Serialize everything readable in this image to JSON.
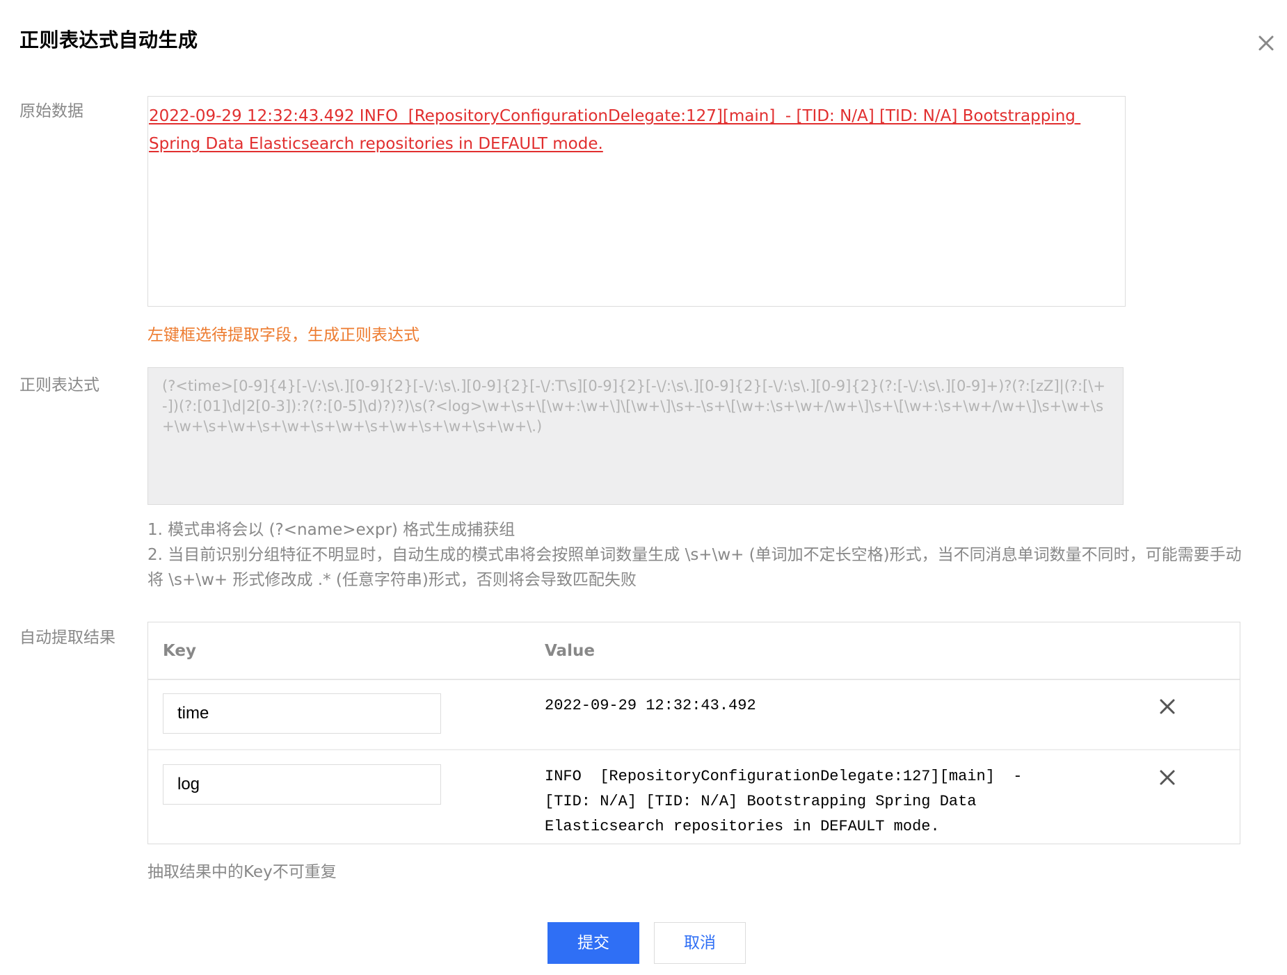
{
  "dialog": {
    "title": "正则表达式自动生成"
  },
  "raw_data": {
    "label": "原始数据",
    "text": "2022-09-29 12:32:43.492 INFO  [RepositoryConfigurationDelegate:127][main]  - [TID: N/A] [TID: N/A] Bootstrapping Spring Data Elasticsearch repositories in DEFAULT mode.",
    "hint": "左键框选待提取字段，生成正则表达式"
  },
  "regex": {
    "label": "正则表达式",
    "value": "(?<time>[0-9]{4}[-\\/:\\s\\.][0-9]{2}[-\\/:\\s\\.][0-9]{2}[-\\/:T\\s][0-9]{2}[-\\/:\\s\\.][0-9]{2}[-\\/:\\s\\.][0-9]{2}(?:[-\\/:\\s\\.][0-9]+)?(?:[zZ]|(?:[\\+-])(?:[01]\\d|2[0-3]):?(?:[0-5]\\d)?)?)\\s(?<log>\\w+\\s+\\[\\w+:\\w+\\]\\[\\w+\\]\\s+-\\s+\\[\\w+:\\s+\\w+/\\w+\\]\\s+\\[\\w+:\\s+\\w+/\\w+\\]\\s+\\w+\\s+\\w+\\s+\\w+\\s+\\w+\\s+\\w+\\s+\\w+\\s+\\w+\\s+\\w+\\.)",
    "note_1": "1. 模式串将会以 (?<name>expr) 格式生成捕获组",
    "note_2": "2. 当目前识别分组特征不明显时，自动生成的模式串将会按照单词数量生成 \\s+\\w+ (单词加不定长空格)形式，当不同消息单词数量不同时，可能需要手动将 \\s+\\w+ 形式修改成 .* (任意字符串)形式，否则将会导致匹配失败"
  },
  "result": {
    "label": "自动提取结果",
    "columns": [
      "Key",
      "Value"
    ],
    "rows": [
      {
        "key": "time",
        "value": "2022-09-29 12:32:43.492"
      },
      {
        "key": "log",
        "value": "INFO  [RepositoryConfigurationDelegate:127][main]  -\n[TID: N/A] [TID: N/A] Bootstrapping Spring Data\nElasticsearch repositories in DEFAULT mode."
      }
    ],
    "note": "抽取结果中的Key不可重复"
  },
  "actions": {
    "submit_label": "提交",
    "cancel_label": "取消"
  },
  "colors": {
    "primary": "#2f6ff5",
    "raw_text": "#e12f2f",
    "hint": "#ed7b2f",
    "muted": "#888888",
    "regex_bg": "#eeeeef"
  },
  "icons": {
    "close": "close-icon",
    "delete": "delete-row-icon"
  }
}
